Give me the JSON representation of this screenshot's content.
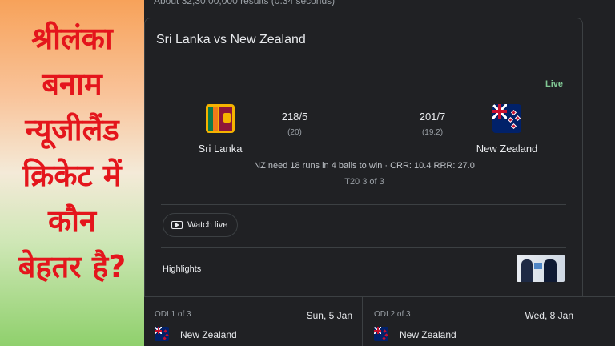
{
  "banner": {
    "lines": [
      "श्रीलंका",
      "बनाम",
      "न्यूजीलैंड",
      "क्रिकेट में",
      "कौन",
      "बेहतर है?"
    ]
  },
  "search": {
    "results_count": "About 32,30,00,000 results (0.34 seconds)"
  },
  "match": {
    "title": "Sri Lanka vs New Zealand",
    "status_badge": "Live",
    "team1": {
      "name": "Sri Lanka",
      "score": "218/5",
      "overs": "(20)",
      "flag": "sri-lanka-flag"
    },
    "team2": {
      "name": "New Zealand",
      "score": "201/7",
      "overs": "(19.2)",
      "flag": "new-zealand-flag"
    },
    "situation": "NZ need 18 runs in 4 balls to win · CRR: 10.4 RRR: 27.0",
    "series": "T20 3 of 3",
    "watch_label": "Watch live",
    "highlights_label": "Highlights"
  },
  "upcoming": [
    {
      "label": "ODI 1 of 3",
      "date": "Sun, 5 Jan",
      "team": "New Zealand"
    },
    {
      "label": "ODI 2 of 3",
      "date": "Wed, 8 Jan",
      "team": "New Zealand"
    }
  ],
  "colors": {
    "banner_text": "#e4151c",
    "background": "#202124",
    "live": "#81c995"
  }
}
